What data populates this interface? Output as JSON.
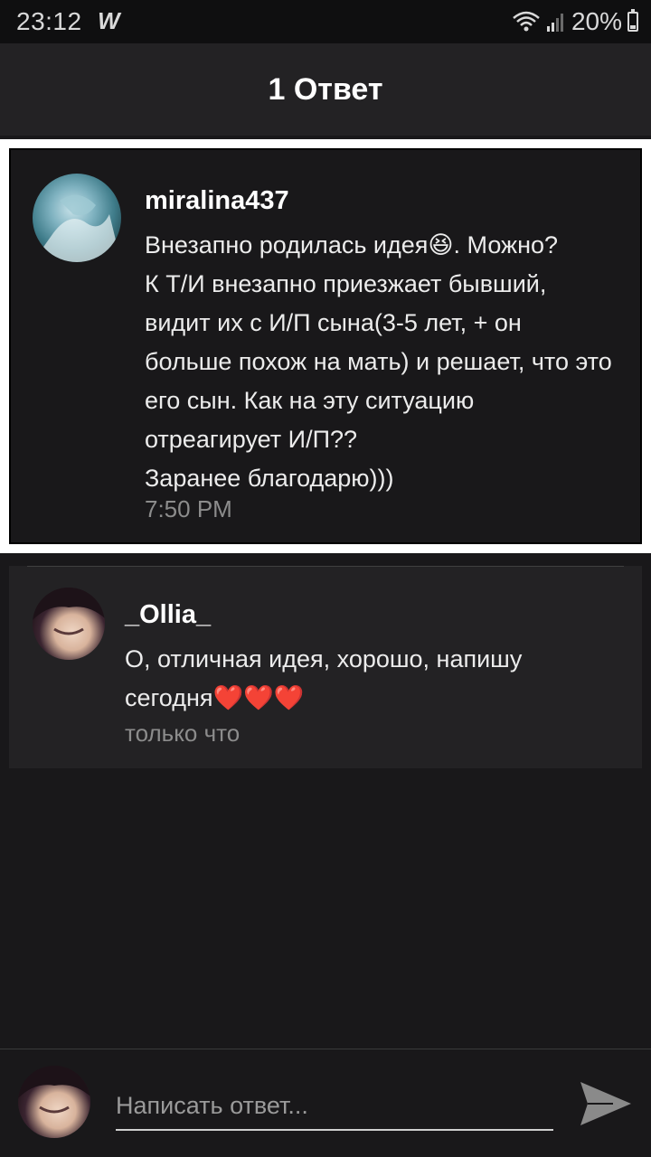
{
  "status_bar": {
    "time": "23:12",
    "app_icon": "W",
    "battery": "20%",
    "icons": [
      "wifi-icon",
      "signal-icon",
      "battery-icon"
    ]
  },
  "header": {
    "title": "1 Ответ"
  },
  "original_comment": {
    "username": "miralina437",
    "text": "Внезапно родилась идея😆. Можно?\nК Т/И внезапно приезжает бывший, видит их с И/П сына(3-5 лет, + он больше похож на мать) и решает, что это его сын. Как на эту ситуацию отреагирует И/П??\nЗаранее благодарю)))",
    "time": "7:50 PM"
  },
  "reply": {
    "username": "_Ollia_",
    "text": "О, отличная идея, хорошо, напишу сегодня❤️❤️❤️",
    "time": "только что"
  },
  "composer": {
    "placeholder": "Написать ответ..."
  },
  "colors": {
    "background": "#19181a",
    "header": "#232224",
    "reply_card": "#232224",
    "muted_text": "#8c8c8c"
  }
}
